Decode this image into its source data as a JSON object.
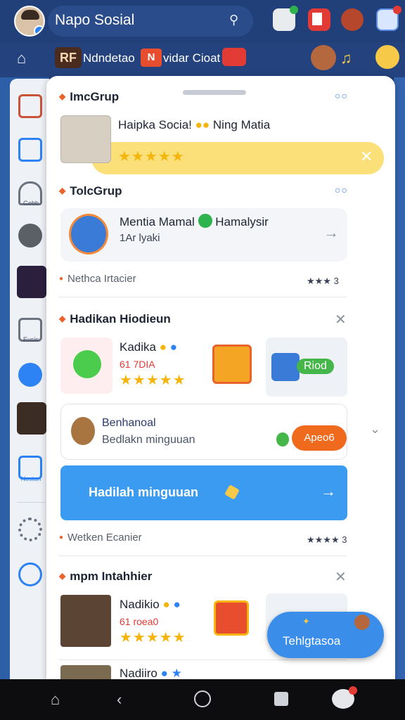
{
  "app": {
    "title": "Napo Sosial"
  },
  "topbar": {
    "search_icon": "search-icon"
  },
  "secbar": {
    "chip1": "RF",
    "text1": "Ndndetao",
    "chip2": "N",
    "text2": "vidar Cioat"
  },
  "sections": [
    {
      "title": "ImcGrup",
      "card": {
        "title": "Haipka Socia!",
        "title2": "Ning Matia",
        "stars": "★★★★★"
      }
    },
    {
      "title": "TolcGrup",
      "card": {
        "title": "Mentia Mamal",
        "title2": "Hamalysir",
        "subtitle": "1Ar lyaki"
      },
      "meta": {
        "label": "Nethca Irtacier",
        "count": "★★★ 3"
      }
    },
    {
      "title": "Hadikan Hiodieun",
      "card": {
        "title": "Kadika",
        "subtitle": "61 7DIA",
        "stars": "★★★★★",
        "tag": "Riod"
      },
      "reward": {
        "title": "Benhanoal",
        "subtitle": "Bedlakn minguuan",
        "button": "Apeo6"
      },
      "cta": {
        "label": "Hadilah minguuan"
      },
      "meta": {
        "label": "Wetken Ecanier",
        "count": "★★★★ 3"
      }
    },
    {
      "title": "mpm Intahhier",
      "card": {
        "title": "Nadikio",
        "subtitle": "61 roea0",
        "stars": "★★★★★"
      },
      "card2": {
        "title": "Nadiiro"
      }
    }
  ],
  "sidebar": {
    "label_a": "Gebb",
    "label_b": "Eusis",
    "label_c": "Nostun"
  },
  "float": {
    "label": "Tehlgtasoa"
  },
  "colors": {
    "accent": "#3a9bf0",
    "orange": "#f06a1e",
    "yellow": "#fbe07a",
    "topbar": "#213f78"
  }
}
